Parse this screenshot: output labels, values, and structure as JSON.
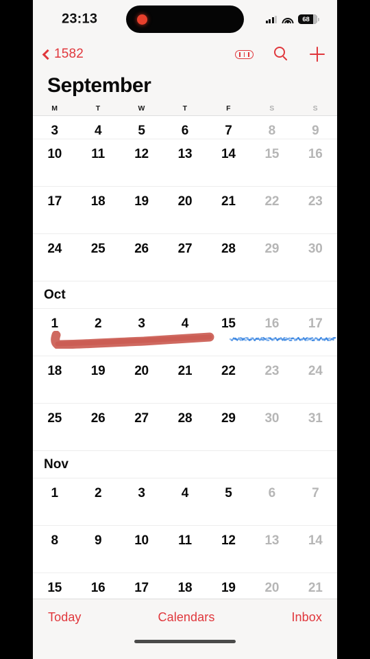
{
  "status_bar": {
    "time": "23:13",
    "cellular_icon": "cellular-signal-icon",
    "wifi_icon": "wifi-icon",
    "battery_percent": "68",
    "recording_indicator": "recording-dot-icon"
  },
  "nav_bar": {
    "back_label": "1582",
    "back_icon": "chevron-left-icon",
    "tracks_icon": "calendar-tracks-icon",
    "search_icon": "search-icon",
    "add_icon": "plus-icon"
  },
  "header": {
    "month_title": "September",
    "weekdays": [
      {
        "label": "M",
        "weekend": false
      },
      {
        "label": "T",
        "weekend": false
      },
      {
        "label": "W",
        "weekend": false
      },
      {
        "label": "T",
        "weekend": false
      },
      {
        "label": "F",
        "weekend": false
      },
      {
        "label": "S",
        "weekend": true
      },
      {
        "label": "S",
        "weekend": true
      }
    ]
  },
  "calendar": {
    "rows": [
      {
        "kind": "week",
        "clipped": true,
        "days": [
          {
            "num": "3",
            "dim": false
          },
          {
            "num": "4",
            "dim": false
          },
          {
            "num": "5",
            "dim": false
          },
          {
            "num": "6",
            "dim": false
          },
          {
            "num": "7",
            "dim": false
          },
          {
            "num": "8",
            "dim": true
          },
          {
            "num": "9",
            "dim": true
          }
        ]
      },
      {
        "kind": "week",
        "clipped": false,
        "days": [
          {
            "num": "10",
            "dim": false
          },
          {
            "num": "11",
            "dim": false
          },
          {
            "num": "12",
            "dim": false
          },
          {
            "num": "13",
            "dim": false
          },
          {
            "num": "14",
            "dim": false
          },
          {
            "num": "15",
            "dim": true
          },
          {
            "num": "16",
            "dim": true
          }
        ]
      },
      {
        "kind": "week",
        "clipped": false,
        "days": [
          {
            "num": "17",
            "dim": false
          },
          {
            "num": "18",
            "dim": false
          },
          {
            "num": "19",
            "dim": false
          },
          {
            "num": "20",
            "dim": false
          },
          {
            "num": "21",
            "dim": false
          },
          {
            "num": "22",
            "dim": true
          },
          {
            "num": "23",
            "dim": true
          }
        ]
      },
      {
        "kind": "week",
        "clipped": false,
        "days": [
          {
            "num": "24",
            "dim": false
          },
          {
            "num": "25",
            "dim": false
          },
          {
            "num": "26",
            "dim": false
          },
          {
            "num": "27",
            "dim": false
          },
          {
            "num": "28",
            "dim": false
          },
          {
            "num": "29",
            "dim": true
          },
          {
            "num": "30",
            "dim": true
          }
        ]
      },
      {
        "kind": "month",
        "label": "Oct"
      },
      {
        "kind": "week",
        "clipped": false,
        "marked": true,
        "days": [
          {
            "num": "1",
            "dim": false
          },
          {
            "num": "2",
            "dim": false
          },
          {
            "num": "3",
            "dim": false
          },
          {
            "num": "4",
            "dim": false
          },
          {
            "num": "15",
            "dim": false
          },
          {
            "num": "16",
            "dim": true
          },
          {
            "num": "17",
            "dim": true
          }
        ]
      },
      {
        "kind": "week",
        "clipped": false,
        "days": [
          {
            "num": "18",
            "dim": false
          },
          {
            "num": "19",
            "dim": false
          },
          {
            "num": "20",
            "dim": false
          },
          {
            "num": "21",
            "dim": false
          },
          {
            "num": "22",
            "dim": false
          },
          {
            "num": "23",
            "dim": true
          },
          {
            "num": "24",
            "dim": true
          }
        ]
      },
      {
        "kind": "week",
        "clipped": false,
        "days": [
          {
            "num": "25",
            "dim": false
          },
          {
            "num": "26",
            "dim": false
          },
          {
            "num": "27",
            "dim": false
          },
          {
            "num": "28",
            "dim": false
          },
          {
            "num": "29",
            "dim": false
          },
          {
            "num": "30",
            "dim": true
          },
          {
            "num": "31",
            "dim": true
          }
        ]
      },
      {
        "kind": "month",
        "label": "Nov"
      },
      {
        "kind": "week",
        "clipped": false,
        "days": [
          {
            "num": "1",
            "dim": false
          },
          {
            "num": "2",
            "dim": false
          },
          {
            "num": "3",
            "dim": false
          },
          {
            "num": "4",
            "dim": false
          },
          {
            "num": "5",
            "dim": false
          },
          {
            "num": "6",
            "dim": true
          },
          {
            "num": "7",
            "dim": true
          }
        ]
      },
      {
        "kind": "week",
        "clipped": false,
        "days": [
          {
            "num": "8",
            "dim": false
          },
          {
            "num": "9",
            "dim": false
          },
          {
            "num": "10",
            "dim": false
          },
          {
            "num": "11",
            "dim": false
          },
          {
            "num": "12",
            "dim": false
          },
          {
            "num": "13",
            "dim": true
          },
          {
            "num": "14",
            "dim": true
          }
        ]
      },
      {
        "kind": "week",
        "clipped": false,
        "days": [
          {
            "num": "15",
            "dim": false
          },
          {
            "num": "16",
            "dim": false
          },
          {
            "num": "17",
            "dim": false
          },
          {
            "num": "18",
            "dim": false
          },
          {
            "num": "19",
            "dim": false
          },
          {
            "num": "20",
            "dim": true
          },
          {
            "num": "21",
            "dim": true
          }
        ]
      }
    ]
  },
  "annotations": [
    {
      "name": "red-underline-mark",
      "color": "#c8544a",
      "covers": "Oct 1 through Oct 4"
    },
    {
      "name": "blue-underline-mark",
      "color": "#2f7fe0",
      "covers": "Oct 15 through Oct 17"
    }
  ],
  "toolbar": {
    "today_label": "Today",
    "calendars_label": "Calendars",
    "inbox_label": "Inbox"
  },
  "colors": {
    "accent": "#e0373c",
    "bar_background": "#f7f6f5",
    "page_background": "#ffffff",
    "dim_text": "#b6b6b6"
  }
}
